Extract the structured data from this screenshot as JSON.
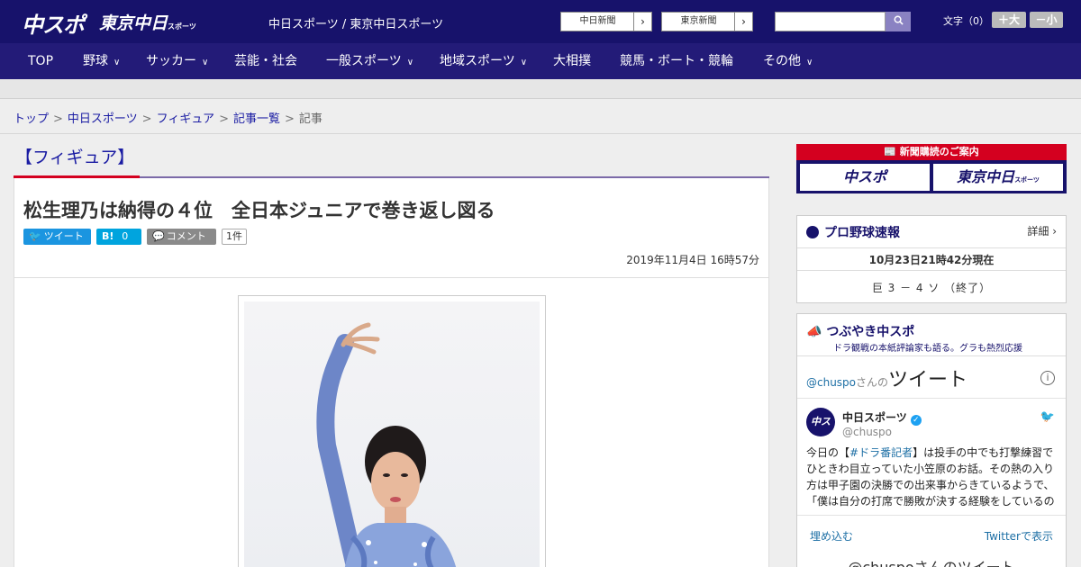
{
  "header": {
    "logo_chuspo": "中スポ",
    "logo_tokyo": "東京中日",
    "logo_tokyo_small": "スポーツ",
    "site_title": "中日スポーツ / 東京中日スポーツ",
    "newspaper_links": [
      "中日新聞",
      "東京新聞"
    ],
    "search_placeholder": "",
    "fontsize_label": "文字（0）",
    "font_larger": "＋大",
    "font_smaller": "－小"
  },
  "nav": {
    "items": [
      {
        "label": "TOP",
        "has_menu": false
      },
      {
        "label": "野球",
        "has_menu": true
      },
      {
        "label": "サッカー",
        "has_menu": true
      },
      {
        "label": "芸能・社会",
        "has_menu": false
      },
      {
        "label": "一般スポーツ",
        "has_menu": true
      },
      {
        "label": "地域スポーツ",
        "has_menu": true
      },
      {
        "label": "大相撲",
        "has_menu": false
      },
      {
        "label": "競馬・ボート・競輪",
        "has_menu": false
      },
      {
        "label": "その他",
        "has_menu": true
      }
    ]
  },
  "breadcrumb": {
    "items": [
      "トップ",
      "中日スポーツ",
      "フィギュア",
      "記事一覧"
    ],
    "current": "記事",
    "separator": ">"
  },
  "article": {
    "category": "【フィギュア】",
    "title": "松生理乃は納得の４位　全日本ジュニアで巻き返し図る",
    "tweet_label": "ツイート",
    "hatena_label": "B!",
    "hatena_count": "0",
    "comment_label": "コメント",
    "comment_count": "1件",
    "date": "2019年11月4日 16時57分"
  },
  "sidebar": {
    "subscription_title": "新聞購読のご案内",
    "subscription_buttons": [
      "中スポ",
      "東京中日"
    ],
    "subscription_small": "スポーツ",
    "baseball": {
      "title": "プロ野球速報",
      "detail": "詳細 ›",
      "time": "10月23日21時42分現在",
      "score": "巨 3 － 4 ソ （終了）"
    },
    "tweets": {
      "title": "つぶやき中スポ",
      "subtitle": "ドラ観戦の本紙評論家も語る。グラも熱烈応援",
      "header_handle": "@chuspo",
      "header_san": "さんの",
      "header_tweet": "ツイート",
      "info": "i",
      "account_name": "中日スポーツ",
      "account_handle": "@chuspo",
      "avatar_text": "中スポ",
      "text_prefix": "今日の【",
      "hashtag": "#ドラ番記者",
      "text_body": "】は投手の中でも打撃練習でひときわ目立っていた小笠原のお話。その熱の入り方は甲子園の決勝での出来事からきているようで、「僕は自分の打席で勝敗が決する経験をしているの",
      "embed": "埋め込む",
      "view_on_twitter": "Twitterで表示",
      "footer": "@chuspoさんのツイート"
    }
  },
  "colors": {
    "header_bg": "#17126b",
    "nav_bg": "#231b78",
    "accent_red": "#d4001f",
    "link": "#1a1ca3",
    "tweet_blue": "#1b95e0",
    "hatena_blue": "#00a4de"
  }
}
